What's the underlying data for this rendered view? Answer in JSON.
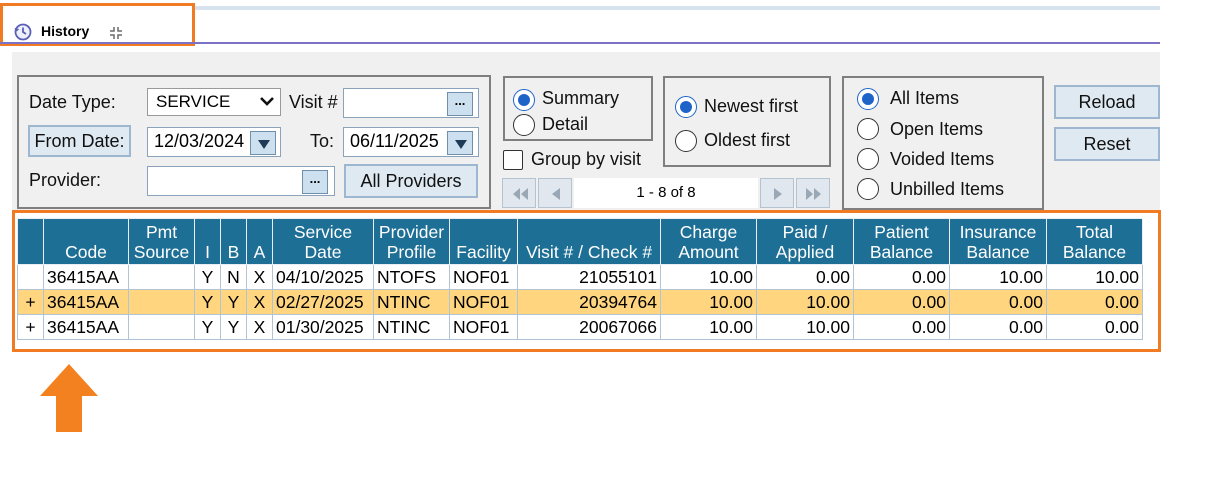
{
  "tab": {
    "title": "History",
    "icon": "history-icon",
    "collapse_icon": "collapse-icon"
  },
  "filters": {
    "date_type_label": "Date Type:",
    "date_type_value": "SERVICE",
    "visit_label": "Visit #",
    "visit_value": "",
    "from_date_button": "From Date:",
    "from_date_value": "12/03/2024",
    "to_label": "To:",
    "to_value": "06/11/2025",
    "provider_label": "Provider:",
    "provider_value": "",
    "all_providers_button": "All Providers",
    "browse_label": "..."
  },
  "view": {
    "summary": "Summary",
    "detail": "Detail",
    "selected": "Summary"
  },
  "group_by_visit": {
    "label": "Group by visit",
    "checked": false
  },
  "sort": {
    "newest": "Newest first",
    "oldest": "Oldest first",
    "selected": "Newest first"
  },
  "pager": {
    "text": "1 - 8 of 8"
  },
  "items_filter": {
    "all": "All Items",
    "open": "Open Items",
    "voided": "Voided Items",
    "unbilled": "Unbilled Items",
    "selected": "All Items"
  },
  "actions": {
    "reload": "Reload",
    "reset": "Reset"
  },
  "table": {
    "columns": [
      "",
      "Code",
      "Pmt Source",
      "I",
      "B",
      "A",
      "Service Date",
      "Provider Profile",
      "Facility",
      "Visit # / Check #",
      "Charge Amount",
      "Paid / Applied",
      "Patient Balance",
      "Insurance Balance",
      "Total Balance"
    ],
    "rows": [
      [
        "",
        "36415AA",
        "",
        "Y",
        "N",
        "X",
        "04/10/2025",
        "NTOFS",
        "NOF01",
        "21055101",
        "10.00",
        "0.00",
        "0.00",
        "10.00",
        "10.00"
      ],
      [
        "+",
        "36415AA",
        "",
        "Y",
        "Y",
        "X",
        "02/27/2025",
        "NTINC",
        "NOF01",
        "20394764",
        "10.00",
        "10.00",
        "0.00",
        "0.00",
        "0.00"
      ],
      [
        "+",
        "36415AA",
        "",
        "Y",
        "Y",
        "X",
        "01/30/2025",
        "NTINC",
        "NOF01",
        "20067066",
        "10.00",
        "10.00",
        "0.00",
        "0.00",
        "0.00"
      ]
    ],
    "selected_row": 1
  },
  "colors": {
    "header_bg": "#1e6f96",
    "selected_row": "#ffd580",
    "highlight": "#f07b22",
    "accent": "#1e64c8"
  }
}
